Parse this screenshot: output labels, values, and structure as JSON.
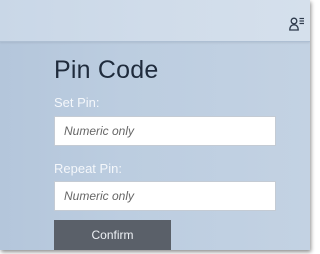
{
  "header": {
    "user_icon": "user-settings-icon"
  },
  "pin_form": {
    "title": "Pin Code",
    "set_pin_label": "Set Pin:",
    "set_pin_placeholder": "Numeric only",
    "set_pin_value": "",
    "repeat_pin_label": "Repeat Pin:",
    "repeat_pin_placeholder": "Numeric only",
    "repeat_pin_value": "",
    "confirm_label": "Confirm"
  },
  "colors": {
    "button": "#5a6069",
    "panel": "#bccde0",
    "title": "#1f2b3c"
  }
}
